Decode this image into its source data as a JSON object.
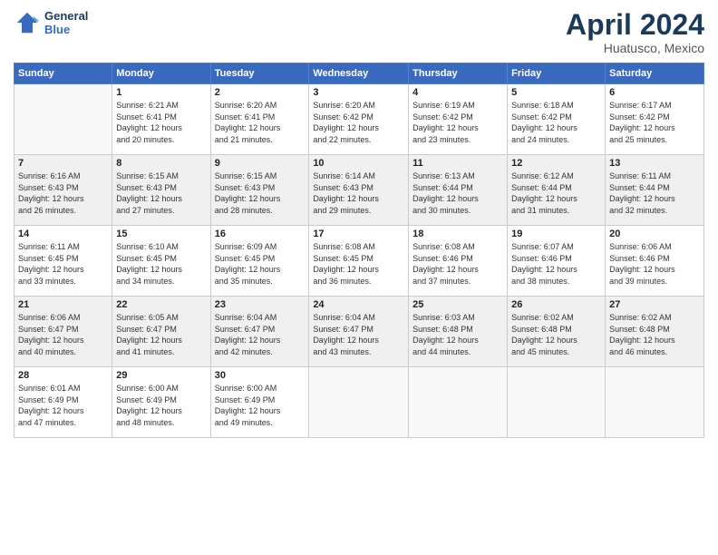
{
  "header": {
    "logo_line1": "General",
    "logo_line2": "Blue",
    "month_title": "April 2024",
    "location": "Huatusco, Mexico"
  },
  "days_of_week": [
    "Sunday",
    "Monday",
    "Tuesday",
    "Wednesday",
    "Thursday",
    "Friday",
    "Saturday"
  ],
  "weeks": [
    [
      {
        "day": "",
        "info": ""
      },
      {
        "day": "1",
        "info": "Sunrise: 6:21 AM\nSunset: 6:41 PM\nDaylight: 12 hours\nand 20 minutes."
      },
      {
        "day": "2",
        "info": "Sunrise: 6:20 AM\nSunset: 6:41 PM\nDaylight: 12 hours\nand 21 minutes."
      },
      {
        "day": "3",
        "info": "Sunrise: 6:20 AM\nSunset: 6:42 PM\nDaylight: 12 hours\nand 22 minutes."
      },
      {
        "day": "4",
        "info": "Sunrise: 6:19 AM\nSunset: 6:42 PM\nDaylight: 12 hours\nand 23 minutes."
      },
      {
        "day": "5",
        "info": "Sunrise: 6:18 AM\nSunset: 6:42 PM\nDaylight: 12 hours\nand 24 minutes."
      },
      {
        "day": "6",
        "info": "Sunrise: 6:17 AM\nSunset: 6:42 PM\nDaylight: 12 hours\nand 25 minutes."
      }
    ],
    [
      {
        "day": "7",
        "info": "Sunrise: 6:16 AM\nSunset: 6:43 PM\nDaylight: 12 hours\nand 26 minutes."
      },
      {
        "day": "8",
        "info": "Sunrise: 6:15 AM\nSunset: 6:43 PM\nDaylight: 12 hours\nand 27 minutes."
      },
      {
        "day": "9",
        "info": "Sunrise: 6:15 AM\nSunset: 6:43 PM\nDaylight: 12 hours\nand 28 minutes."
      },
      {
        "day": "10",
        "info": "Sunrise: 6:14 AM\nSunset: 6:43 PM\nDaylight: 12 hours\nand 29 minutes."
      },
      {
        "day": "11",
        "info": "Sunrise: 6:13 AM\nSunset: 6:44 PM\nDaylight: 12 hours\nand 30 minutes."
      },
      {
        "day": "12",
        "info": "Sunrise: 6:12 AM\nSunset: 6:44 PM\nDaylight: 12 hours\nand 31 minutes."
      },
      {
        "day": "13",
        "info": "Sunrise: 6:11 AM\nSunset: 6:44 PM\nDaylight: 12 hours\nand 32 minutes."
      }
    ],
    [
      {
        "day": "14",
        "info": "Sunrise: 6:11 AM\nSunset: 6:45 PM\nDaylight: 12 hours\nand 33 minutes."
      },
      {
        "day": "15",
        "info": "Sunrise: 6:10 AM\nSunset: 6:45 PM\nDaylight: 12 hours\nand 34 minutes."
      },
      {
        "day": "16",
        "info": "Sunrise: 6:09 AM\nSunset: 6:45 PM\nDaylight: 12 hours\nand 35 minutes."
      },
      {
        "day": "17",
        "info": "Sunrise: 6:08 AM\nSunset: 6:45 PM\nDaylight: 12 hours\nand 36 minutes."
      },
      {
        "day": "18",
        "info": "Sunrise: 6:08 AM\nSunset: 6:46 PM\nDaylight: 12 hours\nand 37 minutes."
      },
      {
        "day": "19",
        "info": "Sunrise: 6:07 AM\nSunset: 6:46 PM\nDaylight: 12 hours\nand 38 minutes."
      },
      {
        "day": "20",
        "info": "Sunrise: 6:06 AM\nSunset: 6:46 PM\nDaylight: 12 hours\nand 39 minutes."
      }
    ],
    [
      {
        "day": "21",
        "info": "Sunrise: 6:06 AM\nSunset: 6:47 PM\nDaylight: 12 hours\nand 40 minutes."
      },
      {
        "day": "22",
        "info": "Sunrise: 6:05 AM\nSunset: 6:47 PM\nDaylight: 12 hours\nand 41 minutes."
      },
      {
        "day": "23",
        "info": "Sunrise: 6:04 AM\nSunset: 6:47 PM\nDaylight: 12 hours\nand 42 minutes."
      },
      {
        "day": "24",
        "info": "Sunrise: 6:04 AM\nSunset: 6:47 PM\nDaylight: 12 hours\nand 43 minutes."
      },
      {
        "day": "25",
        "info": "Sunrise: 6:03 AM\nSunset: 6:48 PM\nDaylight: 12 hours\nand 44 minutes."
      },
      {
        "day": "26",
        "info": "Sunrise: 6:02 AM\nSunset: 6:48 PM\nDaylight: 12 hours\nand 45 minutes."
      },
      {
        "day": "27",
        "info": "Sunrise: 6:02 AM\nSunset: 6:48 PM\nDaylight: 12 hours\nand 46 minutes."
      }
    ],
    [
      {
        "day": "28",
        "info": "Sunrise: 6:01 AM\nSunset: 6:49 PM\nDaylight: 12 hours\nand 47 minutes."
      },
      {
        "day": "29",
        "info": "Sunrise: 6:00 AM\nSunset: 6:49 PM\nDaylight: 12 hours\nand 48 minutes."
      },
      {
        "day": "30",
        "info": "Sunrise: 6:00 AM\nSunset: 6:49 PM\nDaylight: 12 hours\nand 49 minutes."
      },
      {
        "day": "",
        "info": ""
      },
      {
        "day": "",
        "info": ""
      },
      {
        "day": "",
        "info": ""
      },
      {
        "day": "",
        "info": ""
      }
    ]
  ]
}
